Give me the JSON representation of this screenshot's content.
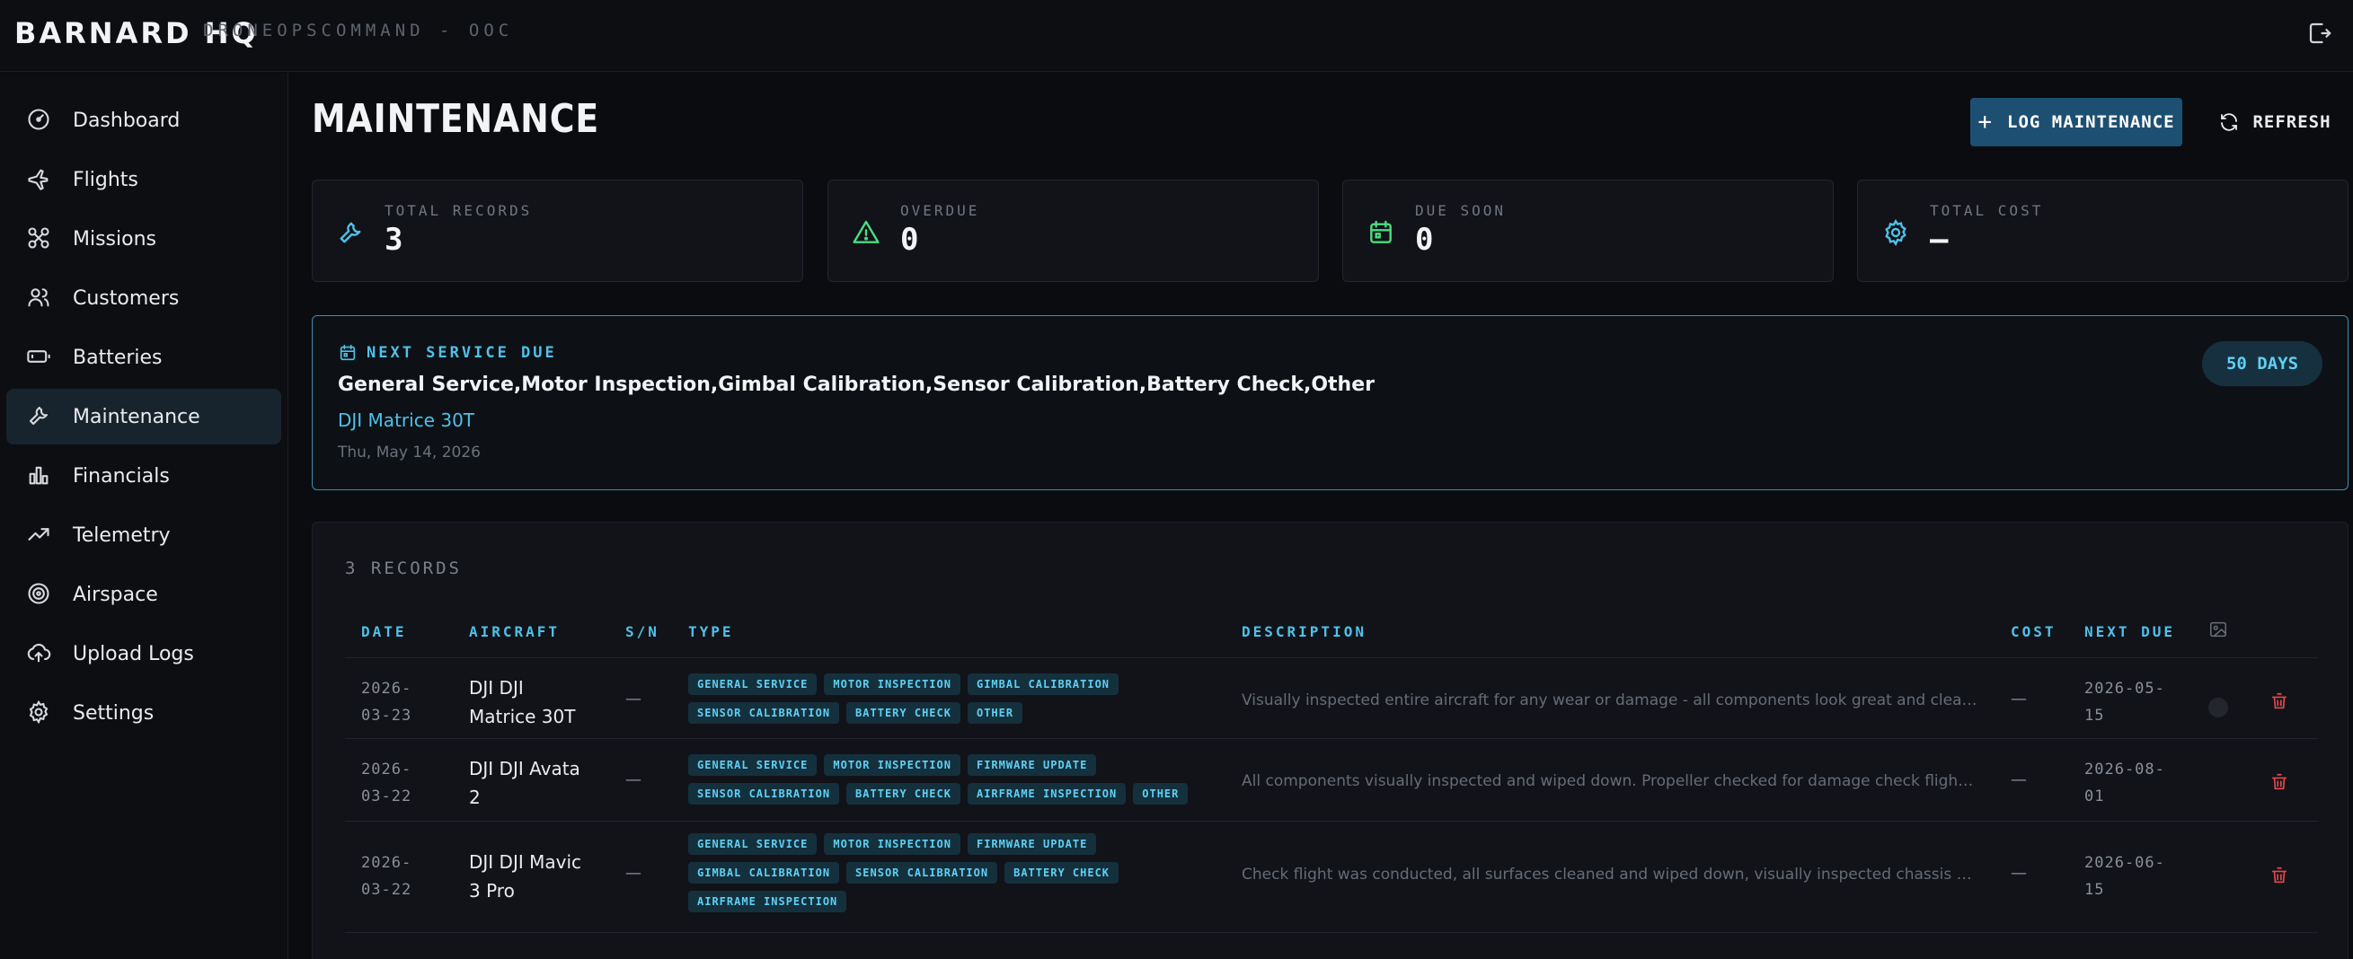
{
  "app": {
    "brand": "BARNARD HQ",
    "subtitle": "DRONEOPSCOMMAND - OOC"
  },
  "sidebar": {
    "items": [
      {
        "label": "Dashboard",
        "icon": "gauge-icon"
      },
      {
        "label": "Flights",
        "icon": "plane-icon"
      },
      {
        "label": "Missions",
        "icon": "drone-icon"
      },
      {
        "label": "Customers",
        "icon": "users-icon"
      },
      {
        "label": "Batteries",
        "icon": "battery-icon"
      },
      {
        "label": "Maintenance",
        "icon": "wrench-icon",
        "active": true
      },
      {
        "label": "Financials",
        "icon": "bar-chart-icon"
      },
      {
        "label": "Telemetry",
        "icon": "activity-icon"
      },
      {
        "label": "Airspace",
        "icon": "radar-icon"
      },
      {
        "label": "Upload Logs",
        "icon": "cloud-upload-icon"
      },
      {
        "label": "Settings",
        "icon": "gear-icon"
      }
    ]
  },
  "header": {
    "title": "MAINTENANCE",
    "log_button": "LOG MAINTENANCE",
    "refresh_button": "REFRESH"
  },
  "stats": [
    {
      "label": "TOTAL RECORDS",
      "value": "3",
      "icon": "wrench-icon",
      "color": "#4fc1ea"
    },
    {
      "label": "OVERDUE",
      "value": "0",
      "icon": "alert-triangle-icon",
      "color": "#4ade80"
    },
    {
      "label": "DUE SOON",
      "value": "0",
      "icon": "calendar-icon",
      "color": "#4ade80"
    },
    {
      "label": "TOTAL COST",
      "value": "—",
      "icon": "gear-icon",
      "color": "#4fc1ea"
    }
  ],
  "next_service": {
    "heading": "NEXT SERVICE DUE",
    "type": "General Service,Motor Inspection,Gimbal Calibration,Sensor Calibration,Battery Check,Other",
    "aircraft": "DJI Matrice 30T",
    "date": "Thu, May 14, 2026",
    "days": "50 DAYS"
  },
  "records": {
    "count_label": "3 RECORDS",
    "columns": [
      "DATE",
      "AIRCRAFT",
      "S/N",
      "TYPE",
      "DESCRIPTION",
      "COST",
      "NEXT DUE"
    ],
    "rows": [
      {
        "date_1": "2026-",
        "date_2": "03-23",
        "aircraft_1": "DJI DJI",
        "aircraft_2": "Matrice 30T",
        "sn": "—",
        "tags": [
          "GENERAL SERVICE",
          "MOTOR INSPECTION",
          "GIMBAL CALIBRATION",
          "SENSOR CALIBRATION",
          "BATTERY CHECK",
          "OTHER"
        ],
        "description": "Visually inspected entire aircraft for any wear or damage - all components look great and clean. Che...",
        "cost": "—",
        "next_1": "2026-05-",
        "next_2": "15"
      },
      {
        "date_1": "2026-",
        "date_2": "03-22",
        "aircraft_1": "DJI DJI Avata",
        "aircraft_2": "2",
        "sn": "—",
        "tags": [
          "GENERAL SERVICE",
          "MOTOR INSPECTION",
          "FIRMWARE UPDATE",
          "SENSOR CALIBRATION",
          "BATTERY CHECK",
          "AIRFRAME INSPECTION",
          "OTHER"
        ],
        "description": "All components visually inspected and wiped down. Propeller checked for damage check flight was...",
        "cost": "—",
        "next_1": "2026-08-",
        "next_2": "01"
      },
      {
        "date_1": "2026-",
        "date_2": "03-22",
        "aircraft_1": "DJI DJI Mavic",
        "aircraft_2": "3 Pro",
        "sn": "—",
        "tags": [
          "GENERAL SERVICE",
          "MOTOR INSPECTION",
          "FIRMWARE UPDATE",
          "GIMBAL CALIBRATION",
          "SENSOR CALIBRATION",
          "BATTERY CHECK",
          "AIRFRAME INSPECTION"
        ],
        "description": "Check flight was conducted, all surfaces cleaned and wiped down, visually inspected chassis and...",
        "cost": "—",
        "next_1": "2026-06-",
        "next_2": "15"
      }
    ]
  },
  "colors": {
    "accent": "#4fc1ea",
    "primary_button": "#1d4f73",
    "success": "#4ade80",
    "danger": "#e5484d"
  }
}
